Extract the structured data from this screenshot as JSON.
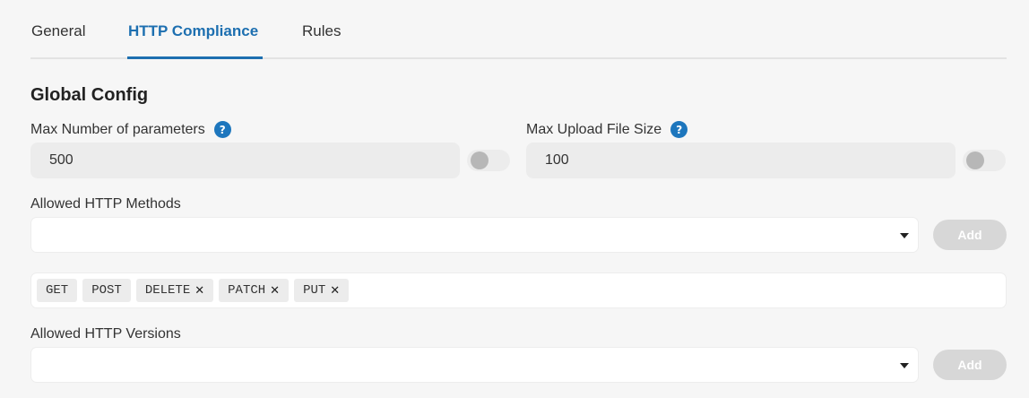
{
  "tabs": [
    {
      "label": "General",
      "active": false
    },
    {
      "label": "HTTP Compliance",
      "active": true
    },
    {
      "label": "Rules",
      "active": false
    }
  ],
  "section_title": "Global Config",
  "max_params": {
    "label": "Max Number of parameters",
    "help_icon": "?",
    "value": "500",
    "toggle_on": false
  },
  "max_upload": {
    "label": "Max Upload File Size",
    "help_icon": "?",
    "value": "100",
    "toggle_on": false
  },
  "methods": {
    "label": "Allowed HTTP Methods",
    "selected": "",
    "add_label": "Add",
    "chips": [
      {
        "label": "GET",
        "removable": false
      },
      {
        "label": "POST",
        "removable": false
      },
      {
        "label": "DELETE",
        "removable": true
      },
      {
        "label": "PATCH",
        "removable": true
      },
      {
        "label": "PUT",
        "removable": true
      }
    ],
    "remove_icon": "✕"
  },
  "versions": {
    "label": "Allowed HTTP Versions",
    "selected": "",
    "add_label": "Add"
  },
  "colors": {
    "accent": "#1d6fb0",
    "background": "#f6f6f6",
    "input_bg": "#ececec",
    "disabled_button": "#d7d7d7"
  }
}
